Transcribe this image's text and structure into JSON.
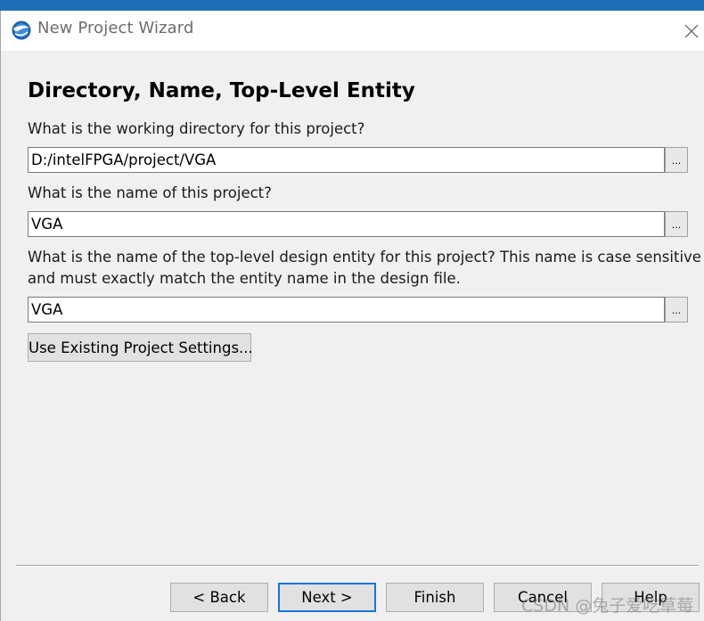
{
  "window": {
    "title": "New Project Wizard",
    "close_glyph": "✕"
  },
  "page": {
    "heading": "Directory, Name, Top-Level Entity"
  },
  "form": {
    "directory_label": "What is the working directory for this project?",
    "directory_value": "D:/intelFPGA/project/VGA",
    "name_label": "What is the name of this project?",
    "name_value": "VGA",
    "entity_label_line1": "What is the name of the top-level design entity for this project? This name is case sensitive",
    "entity_label_line2": "and must exactly match the entity name in the design file.",
    "entity_value": "VGA",
    "browse_label": "...",
    "existing_settings_label": "Use Existing Project Settings..."
  },
  "footer": {
    "back_label": "< Back",
    "next_label": "Next >",
    "finish_label": "Finish",
    "cancel_label": "Cancel",
    "help_label": "Help"
  },
  "watermark": {
    "text": "CSDN @兔子爱吃草莓"
  },
  "colors": {
    "accent": "#1a73d9",
    "title_text": "#6d6d6d",
    "window_bg": "#f0f0f0"
  },
  "icons": {
    "app": "quartus-app-icon",
    "close": "close-icon",
    "browse": "ellipsis-icon"
  }
}
